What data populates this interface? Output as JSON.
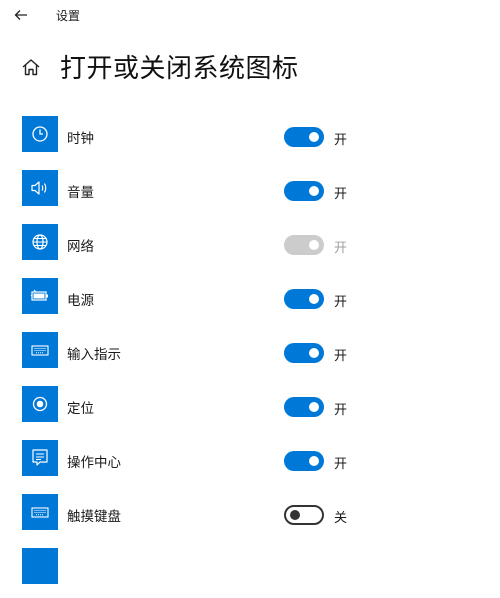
{
  "window": {
    "title": "设置"
  },
  "header": {
    "title": "打开或关闭系统图标"
  },
  "items": [
    {
      "label": "时钟",
      "icon": "clock-icon",
      "state": "开",
      "toggle": "on"
    },
    {
      "label": "音量",
      "icon": "volume-icon",
      "state": "开",
      "toggle": "on"
    },
    {
      "label": "网络",
      "icon": "globe-icon",
      "state": "开",
      "toggle": "disabled"
    },
    {
      "label": "电源",
      "icon": "battery-icon",
      "state": "开",
      "toggle": "on"
    },
    {
      "label": "输入指示",
      "icon": "keyboard-icon",
      "state": "开",
      "toggle": "on"
    },
    {
      "label": "定位",
      "icon": "location-icon",
      "state": "开",
      "toggle": "on"
    },
    {
      "label": "操作中心",
      "icon": "action-center-icon",
      "state": "开",
      "toggle": "on"
    },
    {
      "label": "触摸键盘",
      "icon": "touch-keyboard-icon",
      "state": "关",
      "toggle": "off"
    }
  ],
  "colors": {
    "accent": "#0078d7",
    "disabled": "#cccccc"
  }
}
